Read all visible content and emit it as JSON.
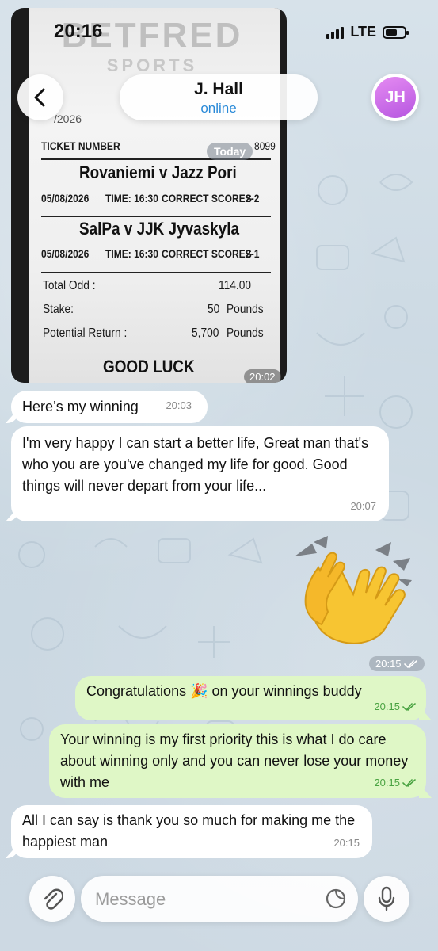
{
  "status_bar": {
    "time": "20:16",
    "network": "LTE"
  },
  "header": {
    "contact_name": "J. Hall",
    "contact_status": "online",
    "avatar_initials": "JH"
  },
  "ticket_image": {
    "brand": "BETFRED",
    "brand_sub": "SPORTS",
    "date_top": "/2026",
    "ticket_label": "TICKET NUMBER",
    "ticket_number_suffix": "8099",
    "day_badge": "Today",
    "matches": [
      {
        "teams": "Rovaniemi v Jazz Pori",
        "date": "05/08/2026",
        "time": "TIME: 16:30",
        "market": "CORRECT SCORES",
        "pick": "2-2"
      },
      {
        "teams": "SalPa v JJK Jyvaskyla",
        "date": "05/08/2026",
        "time": "TIME: 16:30",
        "market": "CORRECT SCORES",
        "pick": "2-1"
      }
    ],
    "total_odd_label": "Total Odd :",
    "total_odd_value": "114.00",
    "stake_label": "Stake:",
    "stake_value": "50",
    "stake_unit": "Pounds",
    "return_label": "Potential Return :",
    "return_value": "5,700",
    "return_unit": "Pounds",
    "footer": "GOOD LUCK",
    "time": "20:02"
  },
  "messages": [
    {
      "text": "Here’s my winning",
      "time": "20:03"
    },
    {
      "text": "I'm very happy I can start a better life, Great man that's who you are you've changed my life for good. Good things will never depart from your life...",
      "time": "20:07"
    },
    {
      "emoji": "👏",
      "time": "20:15"
    },
    {
      "text": "Congratulations 🎉 on your winnings buddy",
      "time": "20:15"
    },
    {
      "text": "Your winning is my first priority this is what I do care about winning only and you can never lose your money with me",
      "time": "20:15"
    },
    {
      "text": "All I can say is thank you so much for making me the happiest man",
      "time": "20:15"
    }
  ],
  "input": {
    "placeholder": "Message"
  },
  "icons": {
    "back": "chevron-left-icon",
    "attach": "paperclip-icon",
    "sticker": "sticker-icon",
    "mic": "microphone-icon",
    "read": "double-check-icon"
  },
  "colors": {
    "incoming": "#ffffff",
    "outgoing": "#dff7c6",
    "online": "#2a8ad8",
    "read_check": "#4aa342",
    "avatar": "#c86ae6"
  }
}
